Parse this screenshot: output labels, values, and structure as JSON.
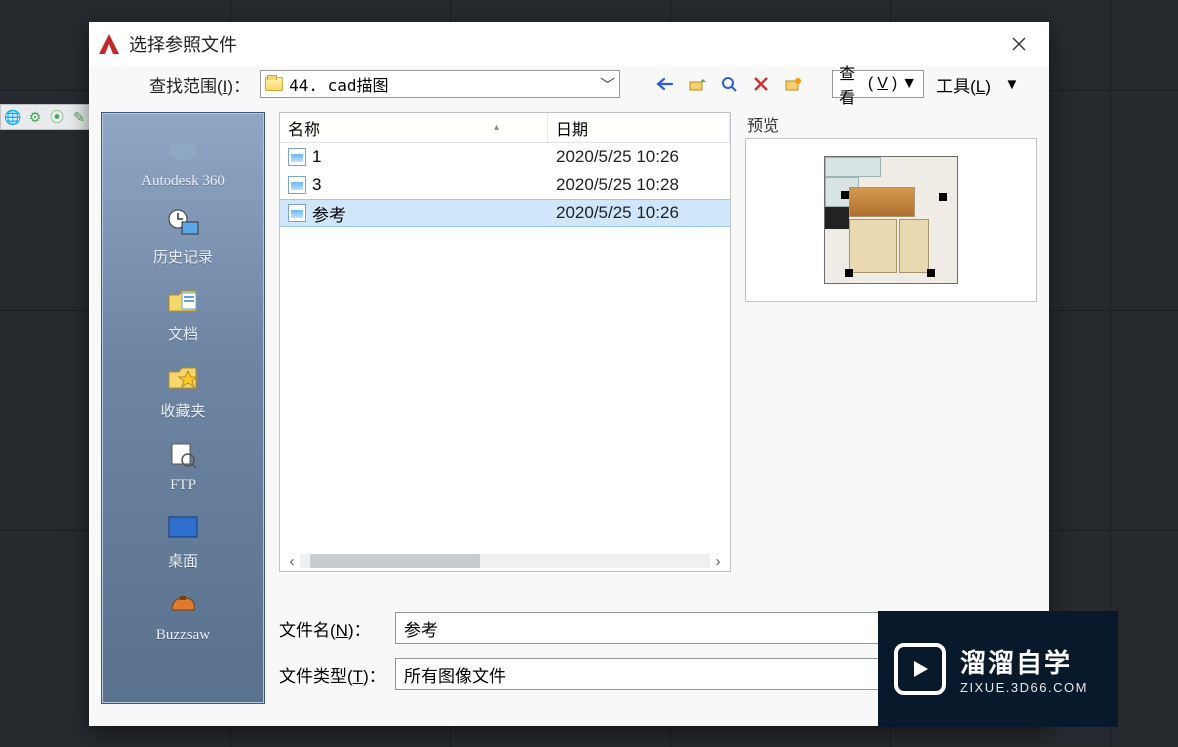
{
  "dialog": {
    "title": "选择参照文件",
    "lookin_label_prefix": "查找范围(",
    "lookin_label_hotkey": "I",
    "lookin_label_suffix": ")：",
    "lookin_value": "44. cad描图",
    "view_label": "查看",
    "view_hotkey": "V",
    "tools_label": "工具(",
    "tools_hotkey": "L",
    "tools_suffix": ")",
    "filename_label_prefix": "文件名(",
    "filename_hotkey": "N",
    "filename_suffix": ")：",
    "filename_value": "参考",
    "filetype_label_prefix": "文件类型(",
    "filetype_hotkey": "T",
    "filetype_suffix": ")：",
    "filetype_value": "所有图像文件",
    "preview_label": "预览"
  },
  "columns": {
    "name": "名称",
    "date": "日期"
  },
  "files": [
    {
      "name": "1",
      "date": "2020/5/25 10:26"
    },
    {
      "name": "3",
      "date": "2020/5/25 10:28"
    },
    {
      "name": "参考",
      "date": "2020/5/25 10:26"
    }
  ],
  "selected_index": 2,
  "places": [
    {
      "id": "autodesk360",
      "label": "Autodesk 360"
    },
    {
      "id": "history",
      "label": "历史记录"
    },
    {
      "id": "documents",
      "label": "文档"
    },
    {
      "id": "favorites",
      "label": "收藏夹"
    },
    {
      "id": "ftp",
      "label": "FTP"
    },
    {
      "id": "desktop",
      "label": "桌面"
    },
    {
      "id": "buzzsaw",
      "label": "Buzzsaw"
    }
  ],
  "watermark": {
    "line1": "溜溜自学",
    "line2": "ZIXUE.3D66.COM"
  }
}
